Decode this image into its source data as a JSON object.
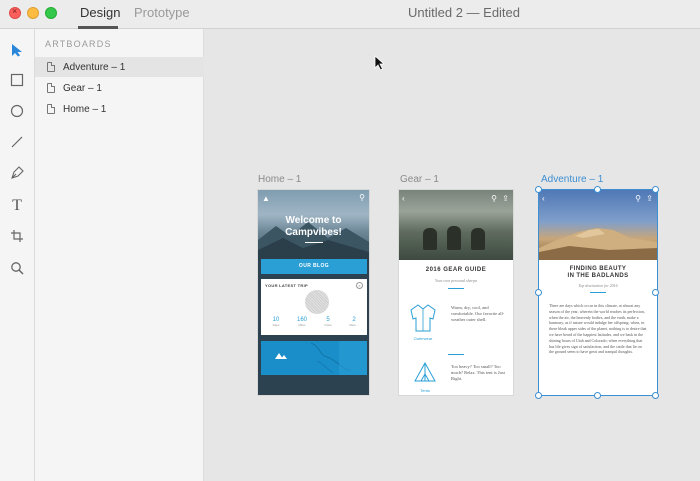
{
  "window": {
    "tabs": [
      {
        "label": "Design",
        "active": true
      },
      {
        "label": "Prototype",
        "active": false
      }
    ],
    "document_title": "Untitled 2 — Edited"
  },
  "toolbar": {
    "tools": [
      "select-tool",
      "rectangle-tool",
      "ellipse-tool",
      "line-tool",
      "pen-tool",
      "text-tool",
      "artboard-tool",
      "zoom-tool"
    ],
    "text_tool_glyph": "T"
  },
  "layers": {
    "heading": "ARTBOARDS",
    "items": [
      {
        "label": "Adventure – 1",
        "selected": true
      },
      {
        "label": "Gear – 1",
        "selected": false
      },
      {
        "label": "Home – 1",
        "selected": false
      }
    ]
  },
  "canvas": {
    "accent_color": "#3d8fd1",
    "artboards": {
      "home": {
        "label": "Home – 1",
        "welcome": "Welcome to Campvibes!",
        "button": "OUR BLOG",
        "card_title": "YOUR LATEST TRIP",
        "stats": [
          {
            "value": "10",
            "label": "Days"
          },
          {
            "value": "160",
            "label": "Miles"
          },
          {
            "value": "5",
            "label": "Cities"
          },
          {
            "value": "2",
            "label": "Mem..."
          }
        ]
      },
      "gear": {
        "label": "Gear – 1",
        "title": "2016 GEAR GUIDE",
        "subtitle": "Your own personal sherpa",
        "text1": "Warm, dry, cool, and comfortable. Our favorite all-weather outer shell.",
        "text1_label": "Outerwear",
        "text2": "Too heavy? Too small? Too much? Relax. This tent is Just Right.",
        "text2_label": "Tents"
      },
      "adventure": {
        "label": "Adventure – 1",
        "title": "FINDING BEAUTY IN THE BADLANDS",
        "subtitle": "Top destination for 2016",
        "body": "There are days which occur in this climate, at almost any season of the year, wherein the world reaches its perfection, when the air, the heavenly bodies, and the earth, make a harmony, as if nature would indulge her offspring; when, in these bleak upper sides of the planet, nothing is to desire that we have heard of the happiest latitudes, and we bask in the shining hours of Utah and Colorado; when everything that has life gives sign of satisfaction, and the cattle that lie on the ground seem to have great and tranquil thoughts."
      }
    }
  }
}
